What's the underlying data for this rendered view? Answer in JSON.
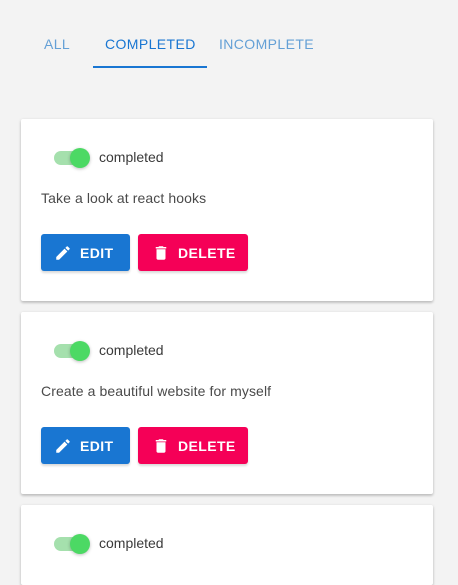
{
  "tabs": {
    "all": "ALL",
    "completed": "COMPLETED",
    "incomplete": "INCOMPLETE",
    "active": "completed"
  },
  "colors": {
    "primary": "#1976d2",
    "danger": "#f50057",
    "switch_on": "#4cd964",
    "background": "#f3f3f3"
  },
  "tasks": [
    {
      "status_label": "completed",
      "text": "Take a look at react hooks",
      "edit_label": "EDIT",
      "delete_label": "DELETE",
      "completed": true
    },
    {
      "status_label": "completed",
      "text": "Create a beautiful website for myself",
      "edit_label": "EDIT",
      "delete_label": "DELETE",
      "completed": true
    },
    {
      "status_label": "completed",
      "completed": true
    }
  ]
}
